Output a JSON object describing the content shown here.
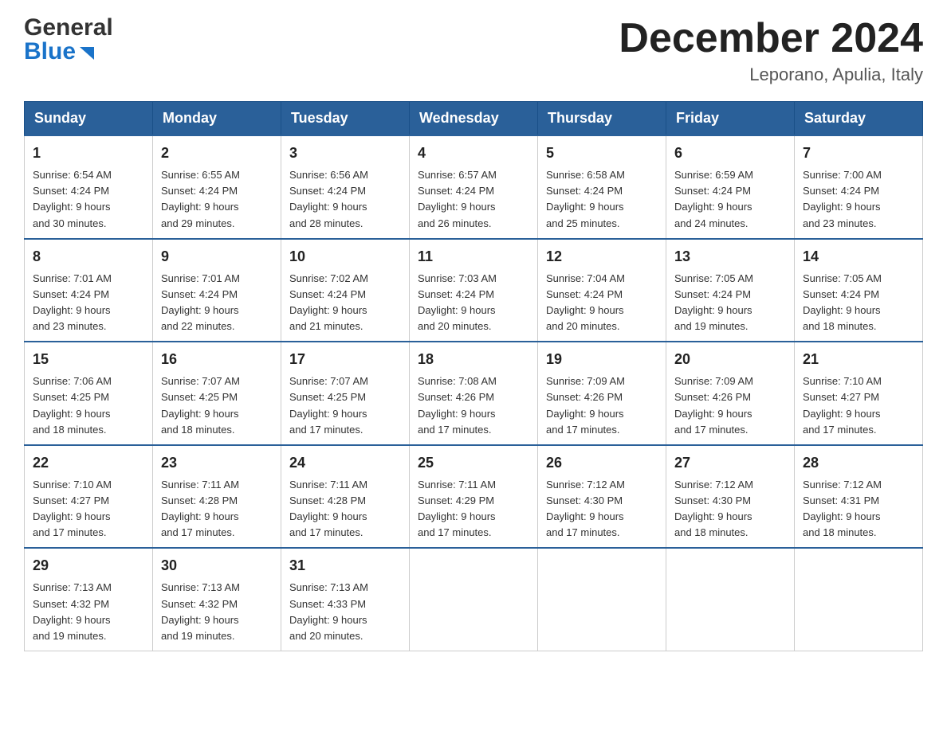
{
  "header": {
    "logo": {
      "general": "General",
      "blue": "Blue"
    },
    "title": "December 2024",
    "location": "Leporano, Apulia, Italy"
  },
  "weekdays": [
    "Sunday",
    "Monday",
    "Tuesday",
    "Wednesday",
    "Thursday",
    "Friday",
    "Saturday"
  ],
  "weeks": [
    [
      {
        "day": "1",
        "sunrise": "6:54 AM",
        "sunset": "4:24 PM",
        "daylight": "9 hours and 30 minutes."
      },
      {
        "day": "2",
        "sunrise": "6:55 AM",
        "sunset": "4:24 PM",
        "daylight": "9 hours and 29 minutes."
      },
      {
        "day": "3",
        "sunrise": "6:56 AM",
        "sunset": "4:24 PM",
        "daylight": "9 hours and 28 minutes."
      },
      {
        "day": "4",
        "sunrise": "6:57 AM",
        "sunset": "4:24 PM",
        "daylight": "9 hours and 26 minutes."
      },
      {
        "day": "5",
        "sunrise": "6:58 AM",
        "sunset": "4:24 PM",
        "daylight": "9 hours and 25 minutes."
      },
      {
        "day": "6",
        "sunrise": "6:59 AM",
        "sunset": "4:24 PM",
        "daylight": "9 hours and 24 minutes."
      },
      {
        "day": "7",
        "sunrise": "7:00 AM",
        "sunset": "4:24 PM",
        "daylight": "9 hours and 23 minutes."
      }
    ],
    [
      {
        "day": "8",
        "sunrise": "7:01 AM",
        "sunset": "4:24 PM",
        "daylight": "9 hours and 23 minutes."
      },
      {
        "day": "9",
        "sunrise": "7:01 AM",
        "sunset": "4:24 PM",
        "daylight": "9 hours and 22 minutes."
      },
      {
        "day": "10",
        "sunrise": "7:02 AM",
        "sunset": "4:24 PM",
        "daylight": "9 hours and 21 minutes."
      },
      {
        "day": "11",
        "sunrise": "7:03 AM",
        "sunset": "4:24 PM",
        "daylight": "9 hours and 20 minutes."
      },
      {
        "day": "12",
        "sunrise": "7:04 AM",
        "sunset": "4:24 PM",
        "daylight": "9 hours and 20 minutes."
      },
      {
        "day": "13",
        "sunrise": "7:05 AM",
        "sunset": "4:24 PM",
        "daylight": "9 hours and 19 minutes."
      },
      {
        "day": "14",
        "sunrise": "7:05 AM",
        "sunset": "4:24 PM",
        "daylight": "9 hours and 18 minutes."
      }
    ],
    [
      {
        "day": "15",
        "sunrise": "7:06 AM",
        "sunset": "4:25 PM",
        "daylight": "9 hours and 18 minutes."
      },
      {
        "day": "16",
        "sunrise": "7:07 AM",
        "sunset": "4:25 PM",
        "daylight": "9 hours and 18 minutes."
      },
      {
        "day": "17",
        "sunrise": "7:07 AM",
        "sunset": "4:25 PM",
        "daylight": "9 hours and 17 minutes."
      },
      {
        "day": "18",
        "sunrise": "7:08 AM",
        "sunset": "4:26 PM",
        "daylight": "9 hours and 17 minutes."
      },
      {
        "day": "19",
        "sunrise": "7:09 AM",
        "sunset": "4:26 PM",
        "daylight": "9 hours and 17 minutes."
      },
      {
        "day": "20",
        "sunrise": "7:09 AM",
        "sunset": "4:26 PM",
        "daylight": "9 hours and 17 minutes."
      },
      {
        "day": "21",
        "sunrise": "7:10 AM",
        "sunset": "4:27 PM",
        "daylight": "9 hours and 17 minutes."
      }
    ],
    [
      {
        "day": "22",
        "sunrise": "7:10 AM",
        "sunset": "4:27 PM",
        "daylight": "9 hours and 17 minutes."
      },
      {
        "day": "23",
        "sunrise": "7:11 AM",
        "sunset": "4:28 PM",
        "daylight": "9 hours and 17 minutes."
      },
      {
        "day": "24",
        "sunrise": "7:11 AM",
        "sunset": "4:28 PM",
        "daylight": "9 hours and 17 minutes."
      },
      {
        "day": "25",
        "sunrise": "7:11 AM",
        "sunset": "4:29 PM",
        "daylight": "9 hours and 17 minutes."
      },
      {
        "day": "26",
        "sunrise": "7:12 AM",
        "sunset": "4:30 PM",
        "daylight": "9 hours and 17 minutes."
      },
      {
        "day": "27",
        "sunrise": "7:12 AM",
        "sunset": "4:30 PM",
        "daylight": "9 hours and 18 minutes."
      },
      {
        "day": "28",
        "sunrise": "7:12 AM",
        "sunset": "4:31 PM",
        "daylight": "9 hours and 18 minutes."
      }
    ],
    [
      {
        "day": "29",
        "sunrise": "7:13 AM",
        "sunset": "4:32 PM",
        "daylight": "9 hours and 19 minutes."
      },
      {
        "day": "30",
        "sunrise": "7:13 AM",
        "sunset": "4:32 PM",
        "daylight": "9 hours and 19 minutes."
      },
      {
        "day": "31",
        "sunrise": "7:13 AM",
        "sunset": "4:33 PM",
        "daylight": "9 hours and 20 minutes."
      },
      null,
      null,
      null,
      null
    ]
  ],
  "labels": {
    "sunrise": "Sunrise: ",
    "sunset": "Sunset: ",
    "daylight": "Daylight: "
  }
}
